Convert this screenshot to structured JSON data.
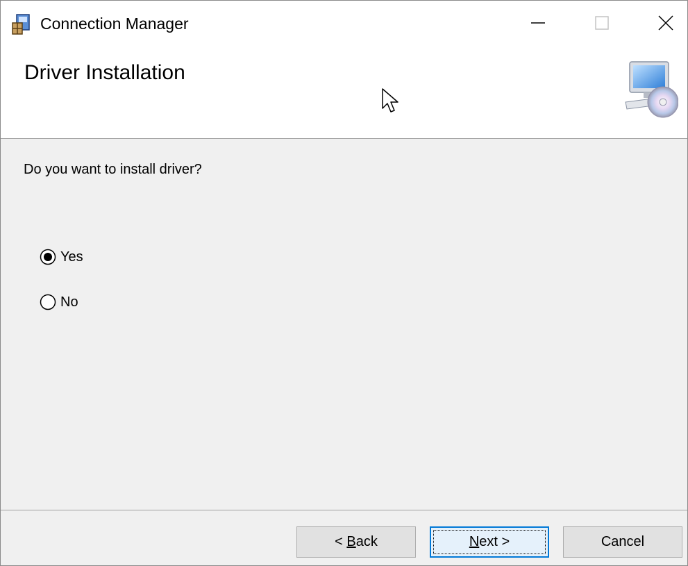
{
  "window": {
    "title": "Connection Manager",
    "minimize_icon": "minimize-icon",
    "maximize_icon": "maximize-icon",
    "close_icon": "close-icon"
  },
  "header": {
    "title": "Driver Installation",
    "icon": "computer-disc-icon"
  },
  "body": {
    "question": "Do you want to install driver?",
    "options": [
      {
        "label": "Yes",
        "selected": true
      },
      {
        "label": "No",
        "selected": false
      }
    ]
  },
  "buttons": {
    "back": {
      "prefix": "< ",
      "mnemonic": "B",
      "rest": "ack"
    },
    "next": {
      "prefix": "",
      "mnemonic": "N",
      "rest": "ext >"
    },
    "cancel": "Cancel"
  },
  "colors": {
    "focus_border": "#0078d7",
    "background": "#f0f0f0"
  }
}
